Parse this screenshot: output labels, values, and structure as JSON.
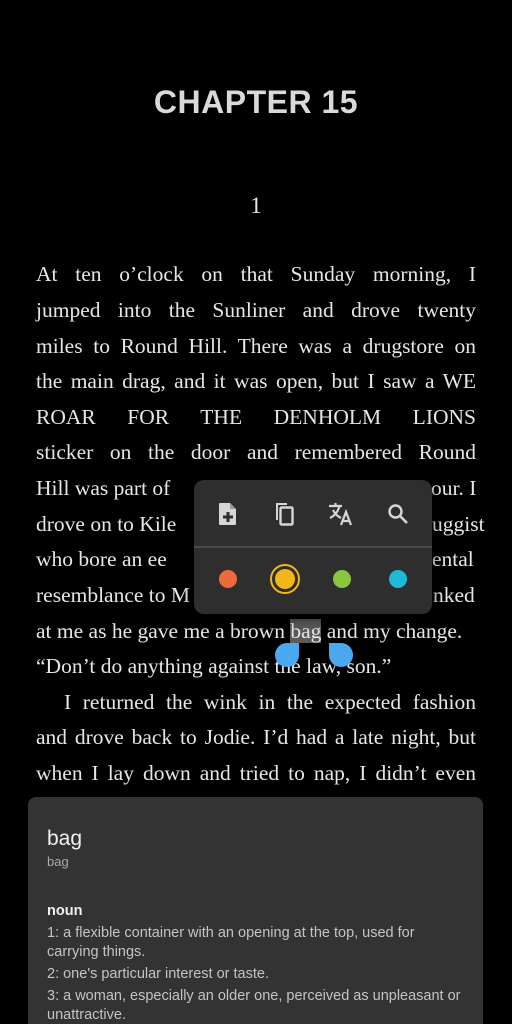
{
  "chapter": {
    "title": "CHAPTER 15",
    "section_number": "1"
  },
  "text_lines": [
    "At ten o’clock on that Sunday morning, I",
    "jumped into the Sunliner and drove twenty",
    "miles to Round Hill. There was a drugstore on",
    "the main drag, and it was open, but I saw a WE",
    "ROAR FOR THE DENHOLM LIONS",
    "sticker on the door and remembered Round",
    "Hill was part of",
    "our. I",
    "drove on to Kile",
    "uggist",
    "who bore an ee",
    "ental",
    "resemblance to M",
    "nked",
    "at me as he gave me a brown ",
    "bag",
    " and my change.",
    "“Don’t do anything against the law, son.”",
    "I returned the wink in the expected fashion",
    "and drove back to Jodie. I’d had a late night, but",
    "when I lay down and tried to nap, I didn’t even"
  ],
  "selection": {
    "word": "bag",
    "handle_color": "#4aa8ef"
  },
  "popup": {
    "actions": [
      {
        "name": "add-note",
        "icon": "note-add-icon"
      },
      {
        "name": "copy",
        "icon": "copy-icon"
      },
      {
        "name": "translate",
        "icon": "translate-icon"
      },
      {
        "name": "search",
        "icon": "search-icon"
      }
    ],
    "highlight_colors": [
      {
        "name": "orange",
        "hex": "#ee6a3c",
        "selected": false
      },
      {
        "name": "yellow",
        "hex": "#f2b51a",
        "selected": true
      },
      {
        "name": "green",
        "hex": "#8cc53f",
        "selected": false
      },
      {
        "name": "cyan",
        "hex": "#1fb8d6",
        "selected": false
      }
    ]
  },
  "dictionary": {
    "word": "bag",
    "phonetic": "bag",
    "part_of_speech": "noun",
    "definitions": [
      "1: a flexible container with an opening at the top, used for carrying things.",
      "2: one's particular interest or taste.",
      "3: a woman, especially an older one, perceived as unpleasant or unattractive."
    ]
  }
}
